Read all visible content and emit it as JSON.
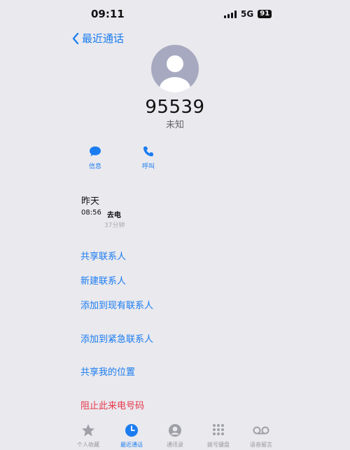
{
  "status": {
    "time": "09:11",
    "network": "5G",
    "battery": "91"
  },
  "nav": {
    "back_label": "最近通话"
  },
  "contact": {
    "number": "95539",
    "subtitle": "未知"
  },
  "actions": [
    {
      "label": "信息",
      "icon": "message-icon"
    },
    {
      "label": "呼叫",
      "icon": "phone-icon"
    }
  ],
  "history": {
    "day": "昨天",
    "time": "08:56",
    "type": "去电",
    "duration": "37分钟"
  },
  "options": [
    {
      "label": "共享联系人"
    },
    {
      "label": "新建联系人"
    },
    {
      "label": "添加到现有联系人"
    },
    {
      "label": "添加到紧急联系人"
    },
    {
      "label": "共享我的位置"
    },
    {
      "label": "阻止此来电号码"
    }
  ],
  "tabs": [
    {
      "label": "个人收藏",
      "icon": "star-icon"
    },
    {
      "label": "最近通话",
      "icon": "clock-icon"
    },
    {
      "label": "通讯录",
      "icon": "contacts-icon"
    },
    {
      "label": "拨号键盘",
      "icon": "keypad-icon"
    },
    {
      "label": "语音留言",
      "icon": "voicemail-icon"
    }
  ],
  "colors": {
    "accent": "#1a7cf0",
    "danger": "#e8364a",
    "background": "#e9e9ee"
  }
}
